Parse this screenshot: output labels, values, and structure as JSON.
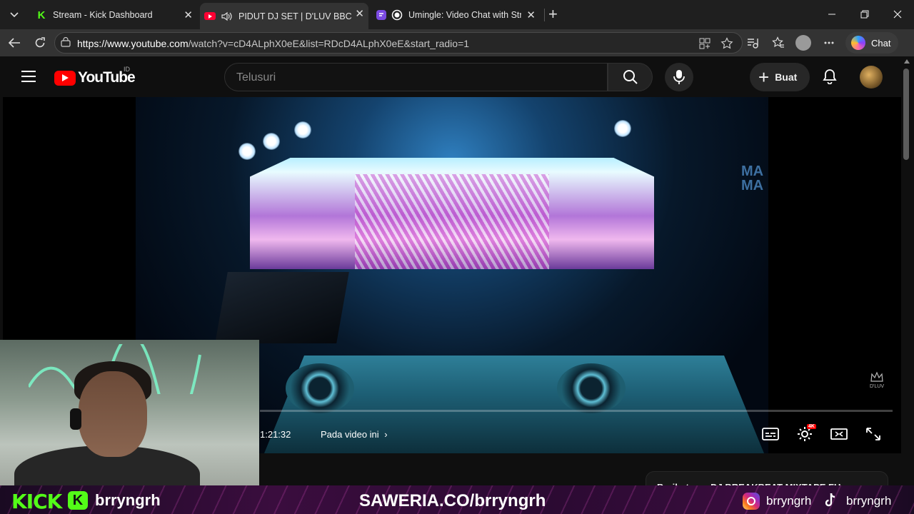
{
  "browser": {
    "tabs": [
      {
        "title": "Stream - Kick Dashboard",
        "favicon": "kick-favicon"
      },
      {
        "title": "PIDUT DJ SET | D'LUV BBC - YouTube",
        "favicon": "youtube-favicon",
        "audio": "speaker-icon"
      },
      {
        "title": "Umingle: Video Chat with Strangers",
        "favicon": "umingle-favicon"
      }
    ],
    "new_tab": "+",
    "url_host": "https://www.youtube.com",
    "url_path": "/watch?v=cD4ALphX0eE&list=RDcD4ALphX0eE&start_radio=1",
    "copilot_label": "Chat"
  },
  "youtube": {
    "logo_text": "YouTube",
    "country_code": "ID",
    "search_placeholder": "Telusuri",
    "create_label": "Buat",
    "player": {
      "time": "1:21:32",
      "chapter": "Pada video ini",
      "screen_text": "MA MA",
      "channel_watermark": "D'LUV",
      "quality_badge": "4K"
    },
    "next_up": "Berikutnya: DJ BREAKBEAT MIXTAPE FU..."
  },
  "overlay": {
    "kick_brand": "KICK",
    "kick_user": "brryngrh",
    "saweria": "SAWERIA.CO/brryngrh",
    "instagram_user": "brryngrh",
    "tiktok_user": "brryngrh",
    "colors": {
      "kick_green": "#53fc18",
      "banner_purple": "#3a0d3e"
    }
  }
}
